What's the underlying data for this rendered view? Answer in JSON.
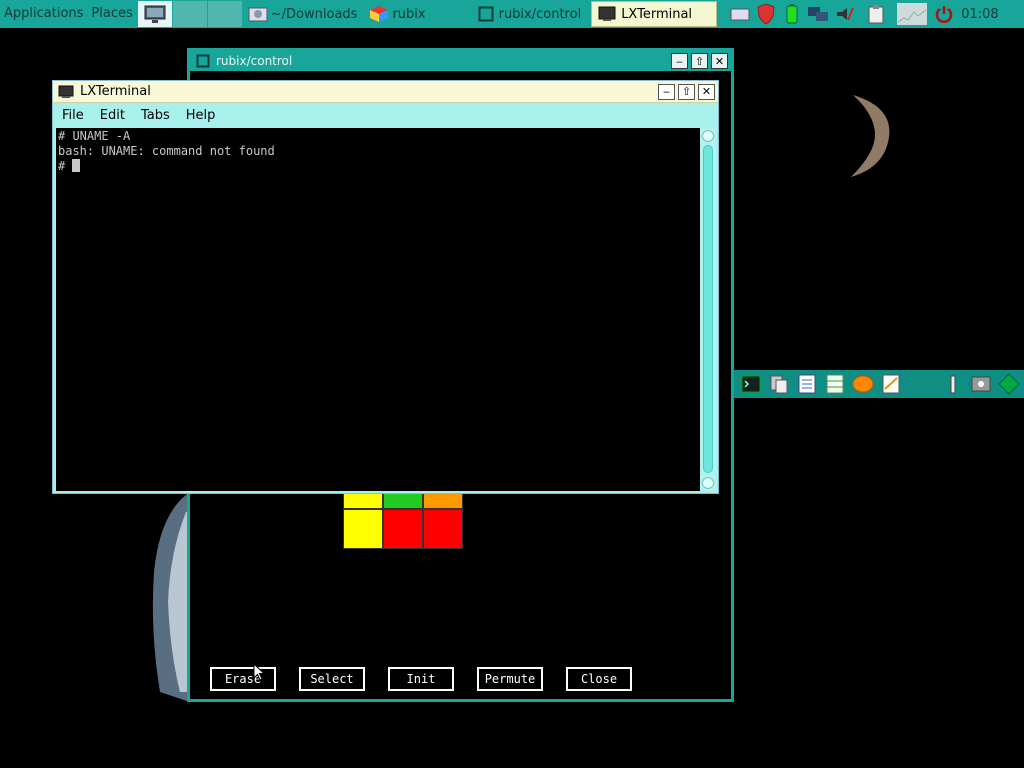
{
  "panel": {
    "applications": "Applications",
    "places": "Places",
    "tasks": [
      "~/Downloads",
      "rubix",
      "rubix/control",
      "LXTerminal"
    ],
    "clock": "01:08"
  },
  "rubix_window": {
    "title": "rubix/control",
    "buttons": [
      "Erase",
      "Select",
      "Init",
      "Permute",
      "Close"
    ],
    "cube_colors": {
      "top": [
        "#ffff00",
        "#22cc22",
        "#ff9900"
      ],
      "bottom": [
        "#ffff00",
        "#ff0000",
        "#ff0000"
      ]
    }
  },
  "terminal": {
    "title": "LXTerminal",
    "menu": [
      "File",
      "Edit",
      "Tabs",
      "Help"
    ],
    "lines": [
      "# UNAME -A",
      "bash: UNAME: command not found",
      "# "
    ]
  },
  "colors": {
    "panel": "#19a69a",
    "terminal_bg": "#000000",
    "terminal_fg": "#c8c8c8"
  }
}
